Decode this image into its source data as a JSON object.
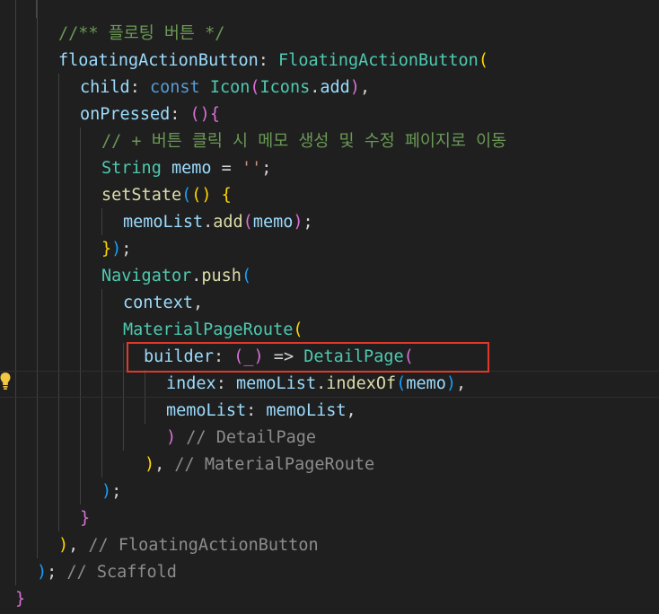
{
  "code": {
    "l0": {
      "comment": "//** 플로팅 버튼 */"
    },
    "l1": {
      "prop": "floatingActionButton",
      "colon": ": ",
      "cls": "FloatingActionButton",
      "open": "("
    },
    "l2": {
      "prop": "child",
      "colon": ": ",
      "kw": "const",
      "cls": "Icon",
      "open": "(",
      "arg_cls": "Icons",
      "dot": ".",
      "arg_prop": "add",
      "close": ")",
      "comma": ","
    },
    "l3": {
      "prop": "onPressed",
      "colon": ": ",
      "parens": "()",
      "brace": "{"
    },
    "l4": {
      "comment": "// + 버튼 클릭 시 메모 생성 및 수정 페이지로 이동"
    },
    "l5": {
      "type": "String",
      "var": "memo",
      "eq": " = ",
      "str": "''",
      "semi": ";"
    },
    "l6": {
      "fn": "setState",
      "open": "(",
      "parens": "()",
      "arrow": " ",
      "brace": "{"
    },
    "l7": {
      "obj": "memoList",
      "dot": ".",
      "fn": "add",
      "open": "(",
      "arg": "memo",
      "close": ")",
      "semi": ";"
    },
    "l8": {
      "brace": "}",
      "close": ")",
      "semi": ";"
    },
    "l9": {
      "cls": "Navigator",
      "dot": ".",
      "fn": "push",
      "open": "("
    },
    "l10": {
      "var": "context",
      "comma": ","
    },
    "l11": {
      "cls": "MaterialPageRoute",
      "open": "("
    },
    "l12": {
      "prop": "builder",
      "colon": ": ",
      "param": "(_)",
      "arrow": " => ",
      "cls": "DetailPage",
      "open": "("
    },
    "l13": {
      "prop": "index",
      "colon": ": ",
      "obj": "memoList",
      "dot": ".",
      "fn": "indexOf",
      "open": "(",
      "arg": "memo",
      "close": ")",
      "comma": ","
    },
    "l14": {
      "prop": "memoList",
      "colon": ": ",
      "val": "memoList",
      "comma": ","
    },
    "l15": {
      "close": ")",
      "comment": " // DetailPage"
    },
    "l16": {
      "close": ")",
      "comma": ",",
      "comment": " // MaterialPageRoute"
    },
    "l17": {
      "close": ")",
      "semi": ";"
    },
    "l18": {
      "brace": "}"
    },
    "l19": {
      "close": ")",
      "comma": ",",
      "comment": " // FloatingActionButton"
    },
    "l20": {
      "close": ")",
      "semi": ";",
      "comment": " // Scaffold"
    },
    "l21": {
      "brace": "}"
    }
  },
  "icons": {
    "lightbulb": "lightbulb-icon"
  },
  "colors": {
    "background": "#1f1f1f",
    "highlight_box": "#e0392b",
    "lightbulb": "#f2c744"
  }
}
